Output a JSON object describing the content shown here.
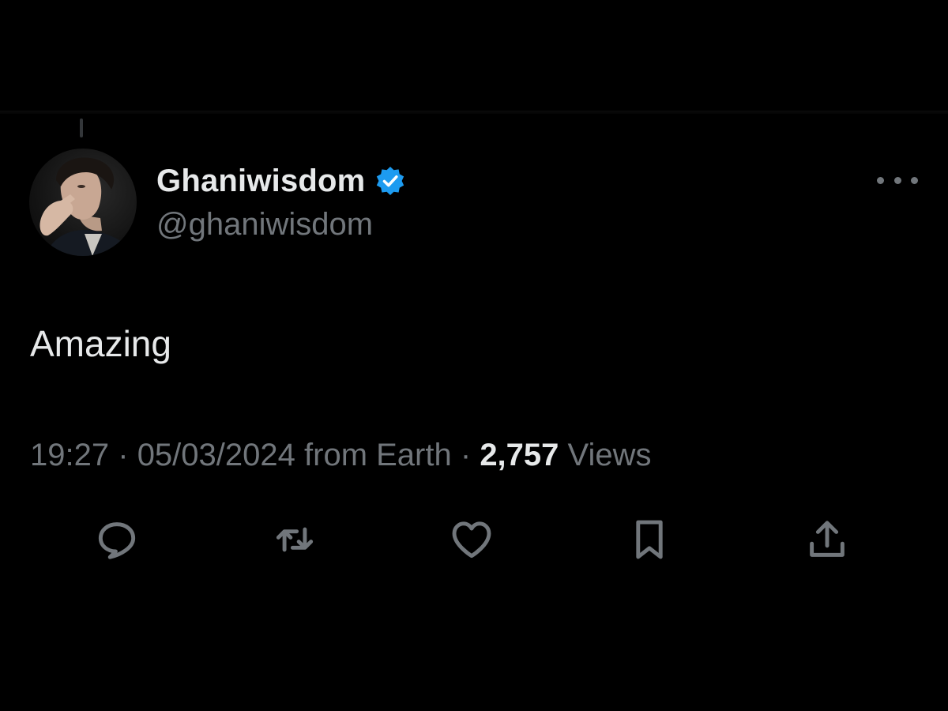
{
  "tweet": {
    "author": {
      "display_name": "Ghaniwisdom",
      "handle": "@ghaniwisdom",
      "verified": true
    },
    "text": "Amazing",
    "meta": {
      "time": "19:27",
      "separator": "·",
      "date": "05/03/2024",
      "source": "from Earth",
      "views_count": "2,757",
      "views_label": "Views"
    }
  },
  "icons": {
    "more": "more-horizontal-icon",
    "verified": "verified-badge-icon",
    "reply": "reply-icon",
    "retweet": "retweet-icon",
    "like": "heart-icon",
    "bookmark": "bookmark-icon",
    "share": "share-icon"
  },
  "colors": {
    "background": "#000000",
    "primary_text": "#e7e9ea",
    "secondary_text": "#71767b",
    "verified_blue": "#1d9bf0"
  }
}
